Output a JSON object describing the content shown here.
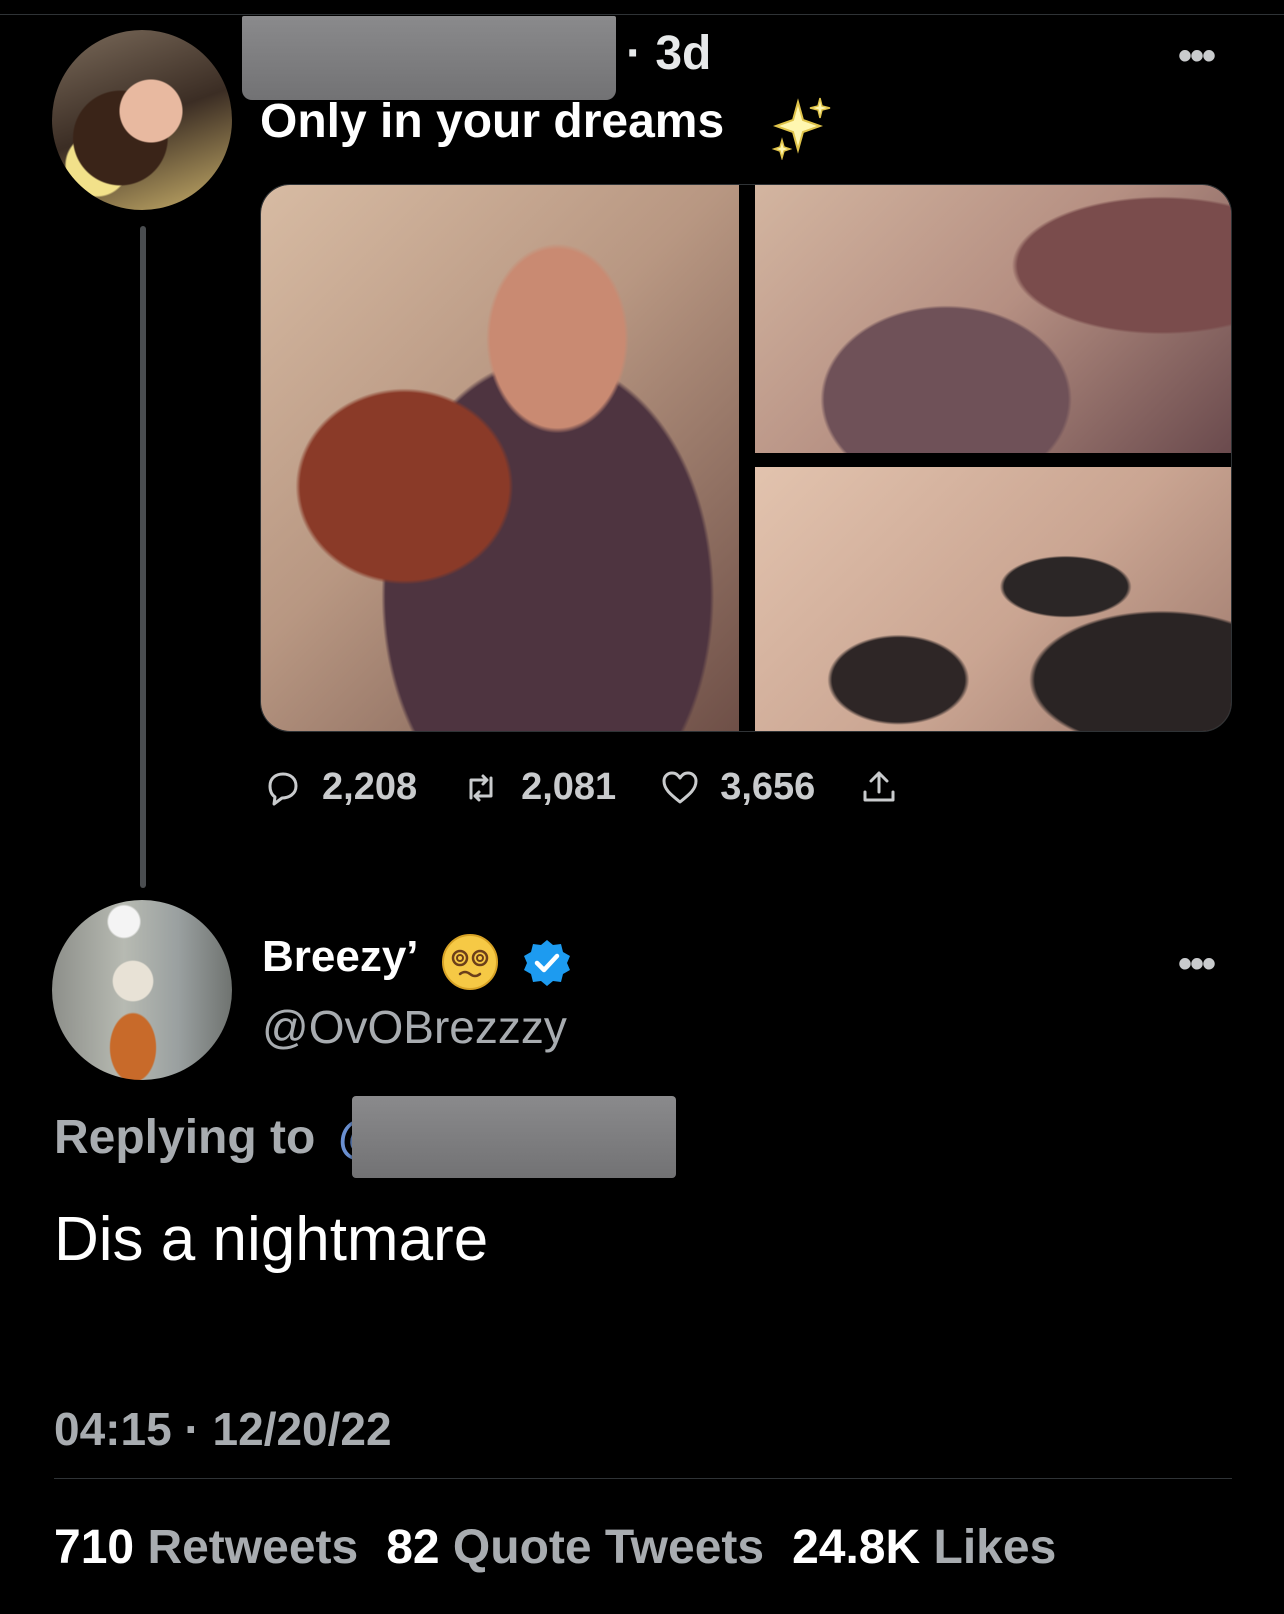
{
  "original_tweet": {
    "time_ago": "· 3d",
    "text": "Only in your dreams",
    "text_emoji": "sparkles-icon",
    "actions": {
      "replies": "2,208",
      "retweets": "2,081",
      "likes": "3,656"
    }
  },
  "reply_tweet": {
    "display_name": "Breezy’",
    "name_emoji": "face-with-spiral-eyes-icon",
    "handle": "@OvOBrezzzy",
    "replying_to_label": "Replying to",
    "replying_to_at": "@",
    "text": "Dis a nightmare",
    "timestamp": "04:15 · 12/20/22",
    "stats": {
      "retweets_count": "710",
      "retweets_label": "Retweets",
      "quotes_count": "82",
      "quotes_label": "Quote Tweets",
      "likes_count": "24.8K",
      "likes_label": "Likes"
    }
  },
  "colors": {
    "background": "#000000",
    "secondary_text": "#a8acb0",
    "verified_blue": "#1d9bf0",
    "link_blue": "#6a8fd0"
  }
}
